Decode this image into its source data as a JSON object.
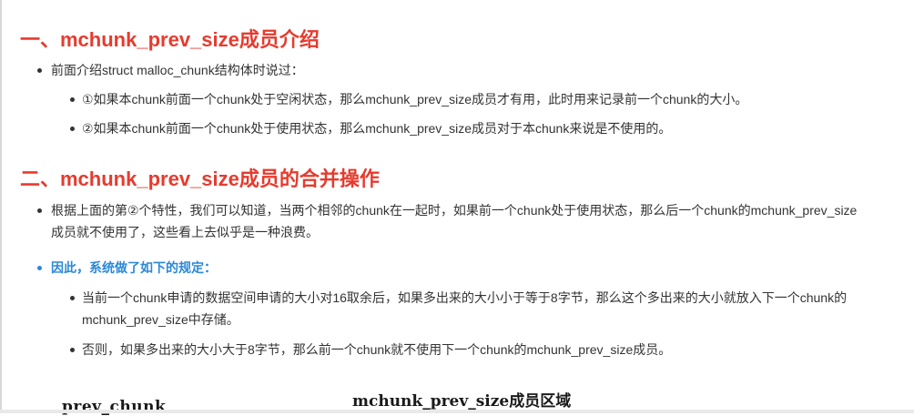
{
  "section1": {
    "heading": "一、mchunk_prev_size成员介绍",
    "intro": "前面介绍struct malloc_chunk结构体时说过：",
    "items": [
      "①如果本chunk前面一个chunk处于空闲状态，那么mchunk_prev_size成员才有用，此时用来记录前一个chunk的大小。",
      "②如果本chunk前面一个chunk处于使用状态，那么mchunk_prev_size成员对于本chunk来说是不使用的。"
    ]
  },
  "section2": {
    "heading": "二、mchunk_prev_size成员的合并操作",
    "para": "根据上面的第②个特性，我们可以知道，当两个相邻的chunk在一起时，如果前一个chunk处于使用状态，那么后一个chunk的mchunk_prev_size成员就不使用了，这些看上去似乎是一种浪费。",
    "highlight": "因此，系统做了如下的规定：",
    "items": [
      "当前一个chunk申请的数据空间申请的大小对16取余后，如果多出来的大小小于等于8字节，那么这个多出来的大小就放入下一个chunk的mchunk_prev_size中存储。",
      "否则，如果多出来的大小大于8字节，那么前一个chunk就不使用下一个chunk的mchunk_prev_size成员。"
    ]
  },
  "figure": {
    "left_label": "prev_chunk",
    "title": "mchunk_prev_size成员区域"
  },
  "colors": {
    "heading": "#e63b2e",
    "highlight": "#2b88d8",
    "text": "#333333"
  }
}
